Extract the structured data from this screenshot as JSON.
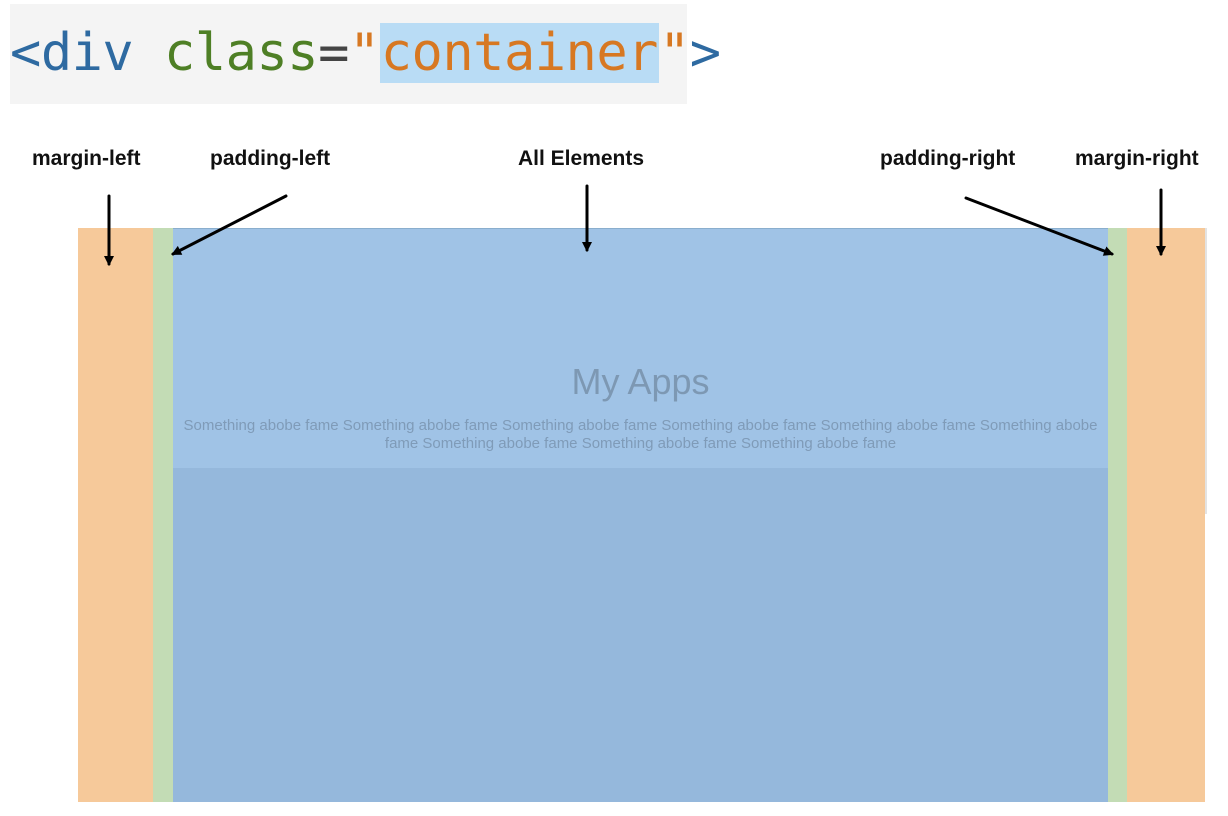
{
  "code": {
    "open_angle": "<",
    "tag": "div",
    "attr": "class",
    "eq": "=",
    "quote_open": "\"",
    "value": "container",
    "quote_close": "\"",
    "close_angle": ">"
  },
  "labels": {
    "margin_left": "margin-left",
    "padding_left": "padding-left",
    "all_elements": "All Elements",
    "padding_right": "padding-right",
    "margin_right": "margin-right"
  },
  "content": {
    "title": "My Apps",
    "text": "Something abobe fame Something abobe fame Something abobe fame Something abobe fame Something abobe fame Something abobe fame Something abobe fame Something abobe fame Something abobe fame"
  },
  "colors": {
    "margin": "#f6c99a",
    "padding": "#c3dcb5",
    "content": "#95b8dc",
    "hero": "#a0c3e6",
    "highlight": "#b9dcf5"
  }
}
